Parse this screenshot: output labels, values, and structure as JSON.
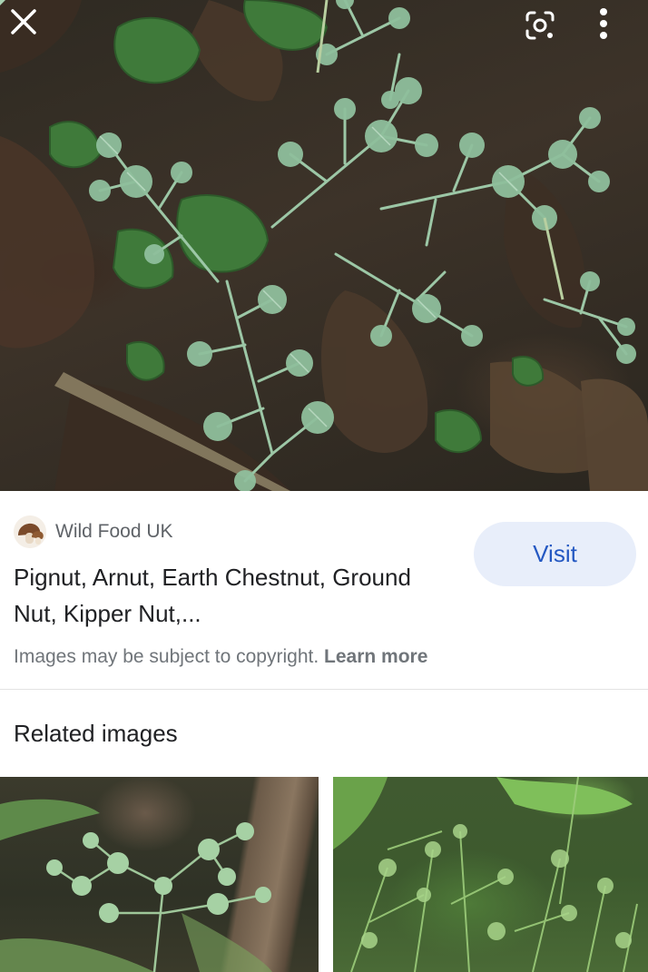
{
  "image_viewer": {
    "close_icon": "close-icon",
    "lens_icon": "google-lens-icon",
    "more_icon": "more-vert-icon"
  },
  "result": {
    "source_name": "Wild Food UK",
    "source_avatar_icon": "mushroom-avatar",
    "title": "Pignut, Arnut, Earth Chestnut, Ground Nut, Kipper Nut,...",
    "visit_label": "Visit",
    "copyright_text": "Images may be subject to copyright.",
    "learn_more_label": "Learn more"
  },
  "related": {
    "heading": "Related images"
  },
  "colors": {
    "visit_bg": "#e8eefa",
    "visit_text": "#2458c2",
    "secondary_text": "#70757a",
    "primary_text": "#202124"
  }
}
